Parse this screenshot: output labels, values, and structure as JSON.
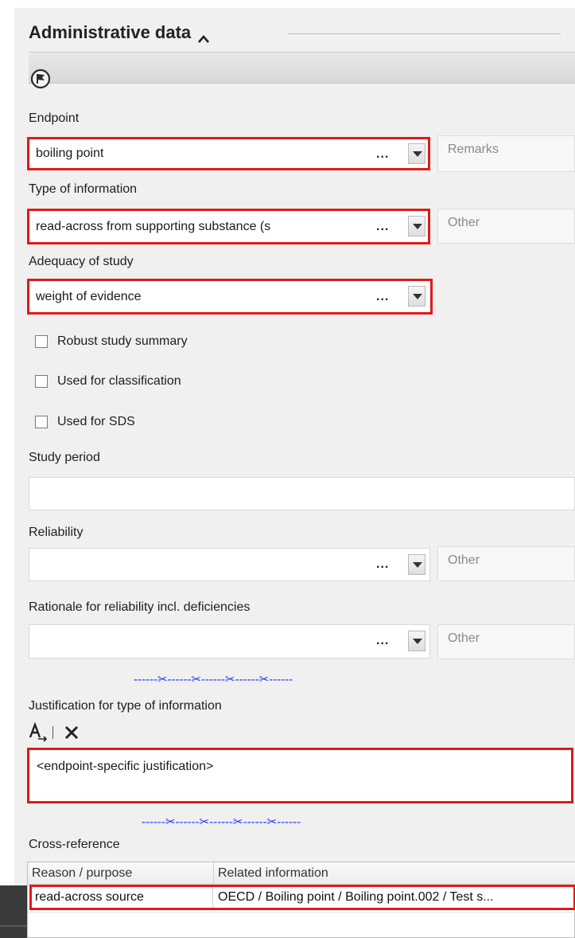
{
  "section": {
    "title": "Administrative data"
  },
  "fields": {
    "endpoint": {
      "label": "Endpoint",
      "value": "boiling point",
      "aux_placeholder": "Remarks"
    },
    "type_of_information": {
      "label": "Type of information",
      "value": "read-across from supporting substance (s",
      "aux_placeholder": "Other"
    },
    "adequacy": {
      "label": "Adequacy of study",
      "value": "weight of evidence"
    },
    "checkboxes": [
      {
        "label": "Robust study summary",
        "checked": false
      },
      {
        "label": "Used for classification",
        "checked": false
      },
      {
        "label": "Used for SDS",
        "checked": false
      }
    ],
    "study_period": {
      "label": "Study period",
      "value": ""
    },
    "reliability": {
      "label": "Reliability",
      "value": "",
      "aux_placeholder": "Other"
    },
    "rationale": {
      "label": "Rationale for reliability incl. deficiencies",
      "value": "",
      "aux_placeholder": "Other"
    }
  },
  "separator": {
    "pattern": "------✂------✂------✂------✂------"
  },
  "justification": {
    "label": "Justification for type of information",
    "value": "<endpoint-specific justification>"
  },
  "cross_reference": {
    "label": "Cross-reference",
    "columns": [
      "Reason / purpose",
      "Related information"
    ],
    "rows": [
      {
        "reason": "read-across source",
        "related": "OECD / Boiling point / Boiling point.002 / Test s..."
      }
    ]
  },
  "ellipsis": "...",
  "icons": {
    "collapse": "chevron-up-icon",
    "flag": "flag-circle-icon",
    "text_format": "text-format-icon",
    "clear": "clear-x-icon"
  },
  "colors": {
    "highlight": "#e01a1a",
    "scissors": "#1a33ff",
    "panel": "#f0f0f0"
  }
}
